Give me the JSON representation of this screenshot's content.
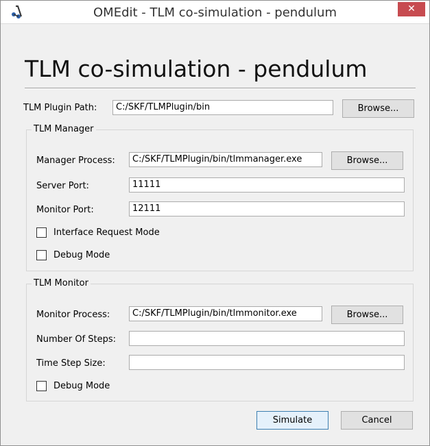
{
  "window": {
    "title": "OMEdit - TLM co-simulation - pendulum",
    "close_glyph": "✕",
    "icon": "omedit-app-icon"
  },
  "dialog": {
    "heading": "TLM co-simulation - pendulum",
    "plugin_path": {
      "label": "TLM Plugin Path:",
      "value": "C:/SKF/TLMPlugin/bin",
      "browse": "Browse..."
    },
    "manager": {
      "title": "TLM Manager",
      "process_label": "Manager Process:",
      "process_value": "C:/SKF/TLMPlugin/bin/tlmmanager.exe",
      "browse": "Browse...",
      "server_port_label": "Server Port:",
      "server_port_value": "11111",
      "monitor_port_label": "Monitor Port:",
      "monitor_port_value": "12111",
      "interface_request_label": "Interface Request Mode",
      "interface_request_checked": false,
      "debug_label": "Debug Mode",
      "debug_checked": false
    },
    "monitor": {
      "title": "TLM Monitor",
      "process_label": "Monitor Process:",
      "process_value": "C:/SKF/TLMPlugin/bin/tlmmonitor.exe",
      "browse": "Browse...",
      "steps_label": "Number Of Steps:",
      "steps_value": "",
      "step_size_label": "Time Step Size:",
      "step_size_value": "",
      "debug_label": "Debug Mode",
      "debug_checked": false
    },
    "buttons": {
      "simulate": "Simulate",
      "cancel": "Cancel"
    }
  }
}
